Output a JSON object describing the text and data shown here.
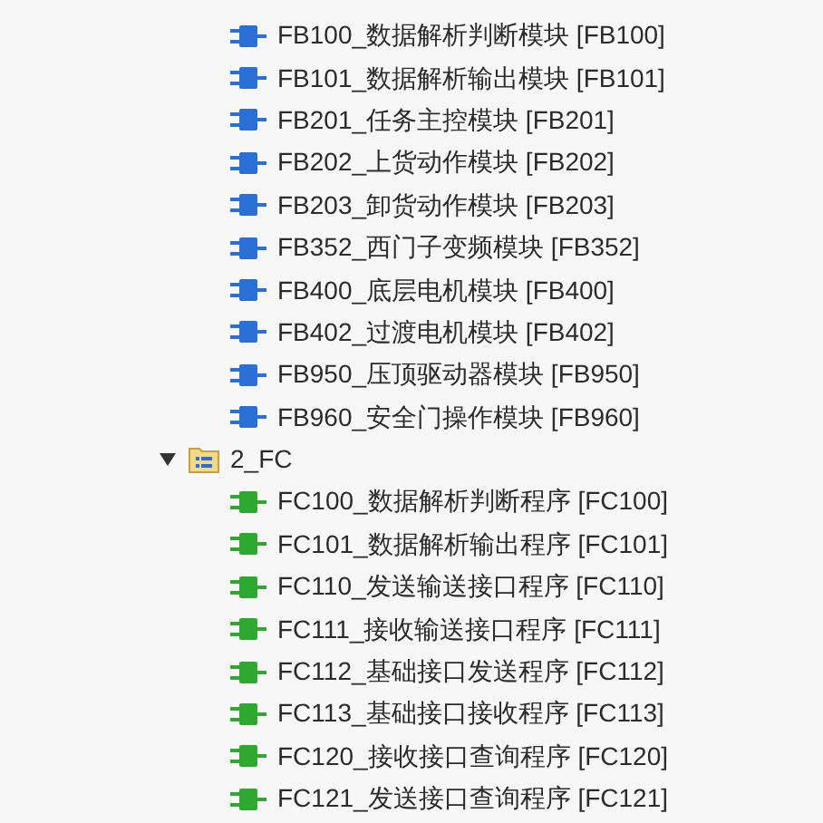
{
  "tree": [
    {
      "kind": "fb",
      "label": "FB100_数据解析判断模块 [FB100]"
    },
    {
      "kind": "fb",
      "label": "FB101_数据解析输出模块 [FB101]"
    },
    {
      "kind": "fb",
      "label": "FB201_任务主控模块 [FB201]"
    },
    {
      "kind": "fb",
      "label": "FB202_上货动作模块 [FB202]"
    },
    {
      "kind": "fb",
      "label": "FB203_卸货动作模块 [FB203]"
    },
    {
      "kind": "fb",
      "label": "FB352_西门子变频模块 [FB352]"
    },
    {
      "kind": "fb",
      "label": "FB400_底层电机模块 [FB400]"
    },
    {
      "kind": "fb",
      "label": "FB402_过渡电机模块 [FB402]"
    },
    {
      "kind": "fb",
      "label": "FB950_压顶驱动器模块 [FB950]"
    },
    {
      "kind": "fb",
      "label": "FB960_安全门操作模块 [FB960]"
    },
    {
      "kind": "folder",
      "label": "2_FC",
      "expanded": true,
      "children": [
        {
          "kind": "fc",
          "label": "FC100_数据解析判断程序 [FC100]"
        },
        {
          "kind": "fc",
          "label": "FC101_数据解析输出程序 [FC101]"
        },
        {
          "kind": "fc",
          "label": "FC110_发送输送接口程序 [FC110]"
        },
        {
          "kind": "fc",
          "label": "FC111_接收输送接口程序 [FC111]"
        },
        {
          "kind": "fc",
          "label": "FC112_基础接口发送程序 [FC112]"
        },
        {
          "kind": "fc",
          "label": "FC113_基础接口接收程序 [FC113]"
        },
        {
          "kind": "fc",
          "label": "FC120_接收接口查询程序 [FC120]"
        },
        {
          "kind": "fc",
          "label": "FC121_发送接口查询程序 [FC121]"
        }
      ]
    }
  ]
}
